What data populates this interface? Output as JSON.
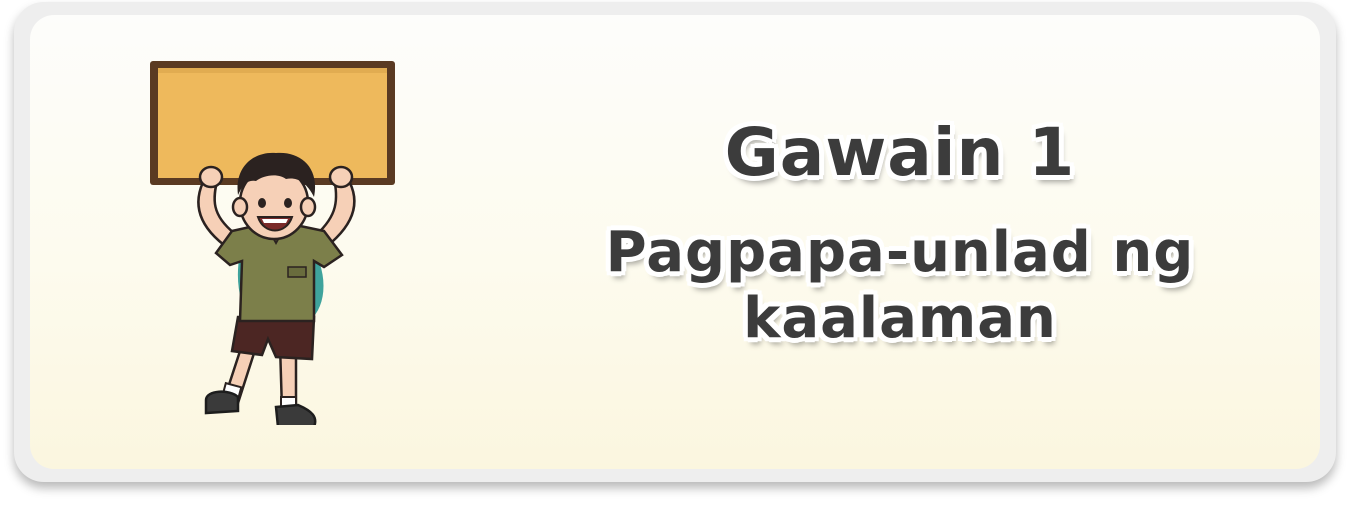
{
  "card": {
    "title": "Gawain 1",
    "subtitle_line1": "Pagpapa-unlad ng",
    "subtitle_line2": "kaalaman"
  },
  "illustration": {
    "icon": "boy-holding-sign-illustration",
    "colors": {
      "board_fill": "#eeb95c",
      "board_frame": "#5a3a22",
      "shirt": "#7c7f4a",
      "shorts": "#4c2623",
      "backpack": "#3fa39c",
      "skin": "#f6d0b7",
      "hair": "#2b2220"
    }
  },
  "colors": {
    "text": "#3c3c3c",
    "text_outline": "#ffffff",
    "card_frame": "#eeeeee",
    "card_bg_bottom": "#fbf6df"
  }
}
